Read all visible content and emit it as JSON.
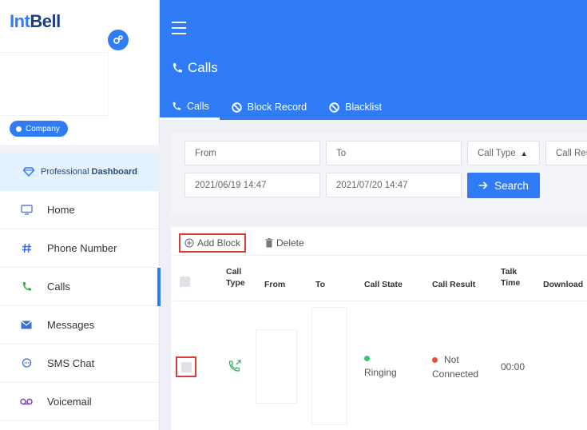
{
  "brand": {
    "int": "Int",
    "bell": "Bell"
  },
  "sidebar": {
    "company_badge": "Company",
    "dashboard": {
      "prefix": "Professional",
      "bold": "Dashboard"
    },
    "items": [
      {
        "label": "Home",
        "icon": "monitor-icon"
      },
      {
        "label": "Phone Number",
        "icon": "hash-icon"
      },
      {
        "label": "Calls",
        "icon": "phone-icon",
        "active": true
      },
      {
        "label": "Messages",
        "icon": "envelope-icon"
      },
      {
        "label": "SMS Chat",
        "icon": "chat-bubble-icon"
      },
      {
        "label": "Voicemail",
        "icon": "voicemail-icon"
      }
    ]
  },
  "header": {
    "title": "Calls",
    "tabs": [
      {
        "label": "Calls",
        "icon": "phone-icon",
        "active": true
      },
      {
        "label": "Block Record",
        "icon": "ban-icon"
      },
      {
        "label": "Blacklist",
        "icon": "ban-icon"
      }
    ]
  },
  "filters": {
    "from_placeholder": "From",
    "to_placeholder": "To",
    "call_type": "Call Type",
    "call_result": "Call Res",
    "date_from": "2021/06/19 14:47",
    "date_to": "2021/07/20 14:47",
    "search_label": "Search"
  },
  "toolbar": {
    "add_block": "Add Block",
    "delete": "Delete"
  },
  "table": {
    "headers": {
      "call_type_1": "Call",
      "call_type_2": "Type",
      "from": "From",
      "to": "To",
      "call_state": "Call State",
      "call_result": "Call Result",
      "talk_time_1": "Talk",
      "talk_time_2": "Time",
      "download": "Download"
    },
    "rows": [
      {
        "call_type": "outgoing-call-icon",
        "from": "",
        "to": "",
        "call_state": "Ringing",
        "call_result_1": "Not",
        "call_result_2": "Connected",
        "talk_time": "00:00"
      }
    ]
  },
  "colors": {
    "primary": "#2f7cf6",
    "ringing": "#2ecc71",
    "not_connected": "#e74c3c",
    "highlight": "#d93a3a"
  }
}
